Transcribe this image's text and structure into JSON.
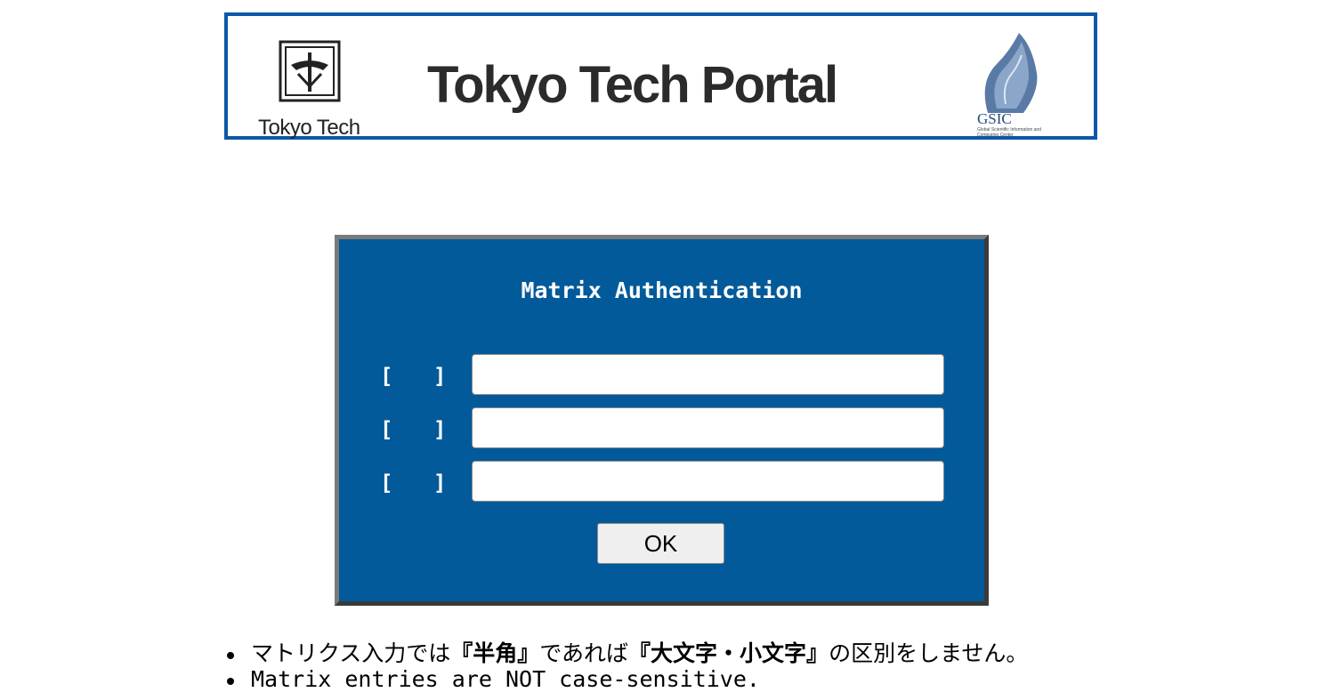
{
  "banner": {
    "university_name": "Tokyo Tech",
    "portal_title": "Tokyo Tech Portal",
    "partner_logo_text": "GSIC",
    "partner_logo_subtext": "Global Scientific Information and Computing Center"
  },
  "auth_panel": {
    "title": "Matrix Authentication",
    "rows": [
      {
        "open_bracket": "[",
        "close_bracket": "]",
        "value": ""
      },
      {
        "open_bracket": "[",
        "close_bracket": "]",
        "value": ""
      },
      {
        "open_bracket": "[",
        "close_bracket": "]",
        "value": ""
      }
    ],
    "ok_label": "OK"
  },
  "notes": {
    "jp_prefix": "マトリクス入力では",
    "jp_term1": "『半角』",
    "jp_middle": "であれば",
    "jp_term2": "『大文字・小文字』",
    "jp_suffix": "の区別をしません。",
    "en": "Matrix entries are NOT case-sensitive."
  },
  "colors": {
    "panel_background": "#025a9a",
    "banner_border": "#0a58a8"
  }
}
